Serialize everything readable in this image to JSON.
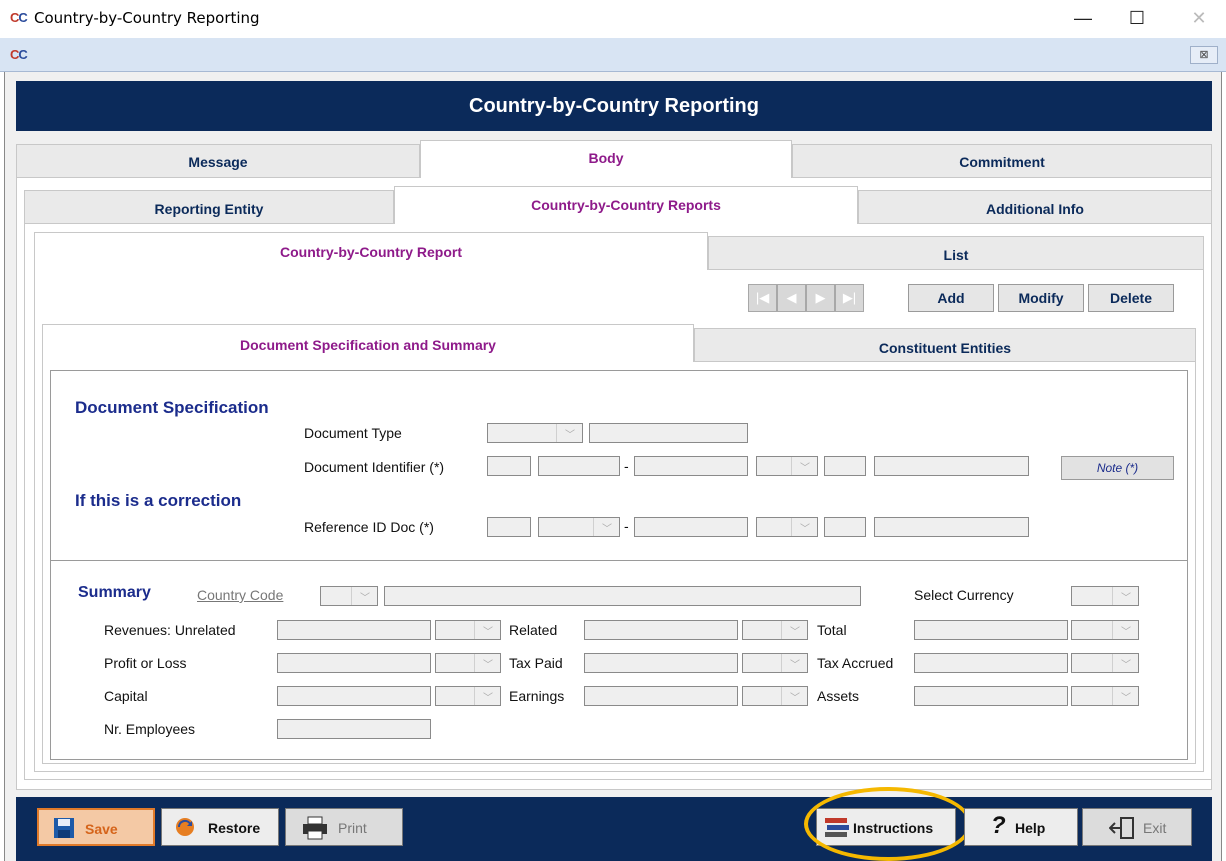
{
  "window": {
    "title": "Country-by-Country Reporting",
    "icon": "CbC-logo-icon",
    "controls": {
      "minimize": "—",
      "maximize": "☐",
      "close": "✕"
    }
  },
  "toolstrip": {
    "close_label": "⊠"
  },
  "banner": {
    "title": "Country-by-Country Reporting"
  },
  "tabs_level1": {
    "message": "Message",
    "body": "Body",
    "commitment": "Commitment"
  },
  "tabs_level2": {
    "reporting_entity": "Reporting Entity",
    "cbc_reports": "Country-by-Country Reports",
    "additional_info": "Additional Info"
  },
  "tabs_level3": {
    "cbc_report": "Country-by-Country Report",
    "list": "List"
  },
  "record_actions": {
    "add": "Add",
    "modify": "Modify",
    "delete": "Delete"
  },
  "tabs_level4": {
    "doc_spec": "Document Specification and Summary",
    "constituent": "Constituent Entities"
  },
  "doc_spec": {
    "heading": "Document Specification",
    "document_type": "Document Type",
    "document_identifier": "Document Identifier (*)",
    "note_button": "Note (*)",
    "correction_heading": "If this is a correction",
    "reference_id": "Reference ID Doc (*)",
    "dash": "-"
  },
  "summary": {
    "heading": "Summary",
    "country_code": "Country Code",
    "select_currency": "Select Currency",
    "revenues_unrelated": "Revenues:  Unrelated",
    "related": "Related",
    "total": "Total",
    "profit_or_loss": "Profit or Loss",
    "tax_paid": "Tax Paid",
    "tax_accrued": "Tax Accrued",
    "capital": "Capital",
    "earnings": "Earnings",
    "assets": "Assets",
    "nr_employees": "Nr. Employees"
  },
  "bottom": {
    "save": "Save",
    "restore": "Restore",
    "print": "Print",
    "instructions": "Instructions",
    "help": "Help",
    "exit": "Exit"
  },
  "colors": {
    "banner": "#0b2a5a",
    "active_tab_text": "#8e1a8a",
    "section_text": "#1b2c8c",
    "highlight_circle": "#f5b800",
    "save_border": "#e07a2a"
  }
}
